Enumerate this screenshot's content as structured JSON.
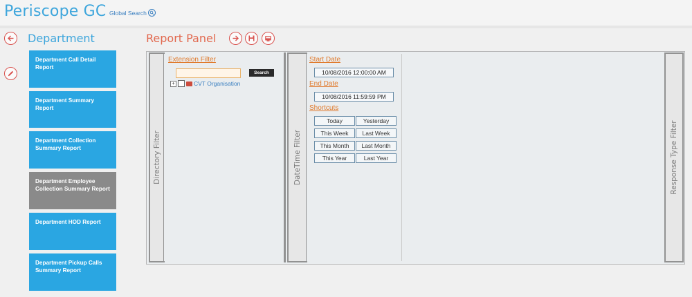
{
  "app": {
    "title": "Periscope GC",
    "global_search": "Global Search"
  },
  "left": {
    "section_title": "Department",
    "reports": [
      {
        "label": "Department Call Detail Report"
      },
      {
        "label": "Department Summary Report"
      },
      {
        "label": "Department Collection Summary Report"
      },
      {
        "label": "Department Employee Collection Summary Report"
      },
      {
        "label": "Department HOD Report"
      },
      {
        "label": "Department Pickup Calls Summary Report"
      }
    ]
  },
  "report_panel": {
    "title": "Report Panel",
    "directory_filter": {
      "tab_label": "Directory Filter",
      "extension_filter_label": "Extension Filter",
      "search_value": "",
      "search_button": "Search",
      "tree": [
        {
          "label": "CVT Organisation"
        }
      ]
    },
    "datetime_filter": {
      "tab_label": "DateTime Filter",
      "start_date_label": "Start Date",
      "start_date_value": "10/08/2016 12:00:00 AM",
      "end_date_label": "End Date",
      "end_date_value": "10/08/2016 11:59:59 PM",
      "shortcuts_label": "Shortcuts",
      "shortcuts": [
        "Today",
        "Yesterday",
        "This Week",
        "Last Week",
        "This Month",
        "Last Month",
        "This Year",
        "Last Year"
      ]
    },
    "response_type_filter": {
      "tab_label": "Response Type Filter"
    }
  },
  "colors": {
    "accent_blue": "#3ea6dc",
    "tile_blue": "#2aa6e2",
    "tile_active": "#8a8a8a",
    "accent_red": "#d9534f",
    "link_orange": "#e07a2c"
  }
}
